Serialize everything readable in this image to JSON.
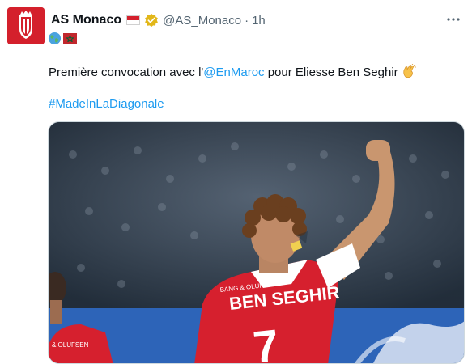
{
  "tweet": {
    "author_name": "AS Monaco",
    "handle": "@AS_Monaco",
    "separator": "·",
    "time": "1h",
    "text_before": "Première convocation avec l'",
    "mention": "@EnMaroc",
    "text_after": " pour Eliesse Ben Seghir",
    "hashtag": "#MadeInLaDiagonale"
  },
  "photo": {
    "jersey_name": "BEN SEGHIR",
    "jersey_number": "7",
    "sponsor": "BANG & OLUFSEN",
    "other_player_sponsor": "& OLUFSEN"
  },
  "colors": {
    "accent_link": "#1d9bf0",
    "secondary_text": "#536471",
    "monaco_red": "#d4202c",
    "verified_gold": "#e2b719"
  },
  "icons": {
    "avatar": "as-monaco-crest",
    "name_flag": "monaco-flag",
    "verified": "gold-verified-badge",
    "more": "more-horizontal-icon",
    "badge1": "globe-icon",
    "badge2": "morocco-flag",
    "emoji": "clapping-hands"
  }
}
